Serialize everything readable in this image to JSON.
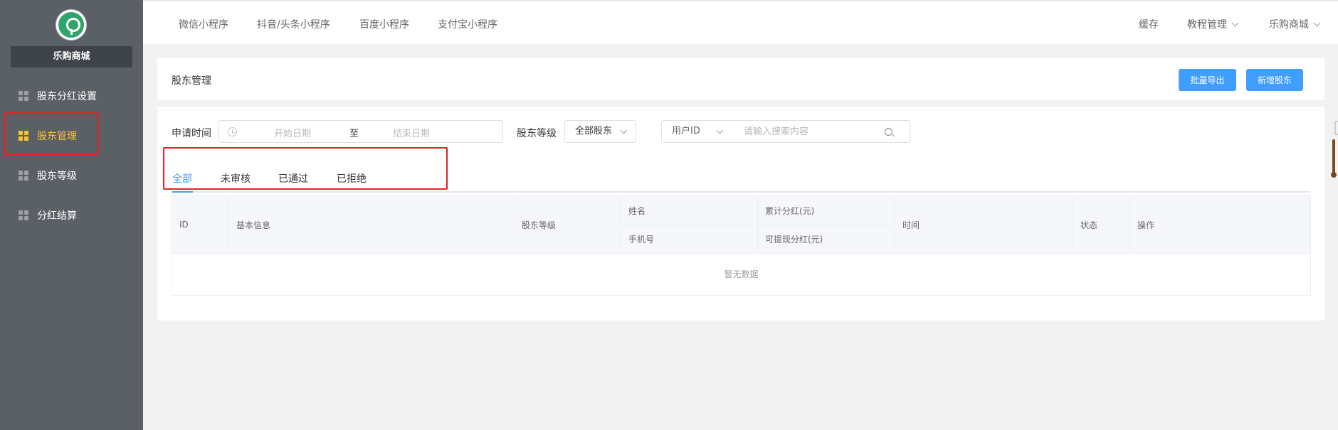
{
  "sidebar": {
    "store_name": "乐购商城",
    "items": [
      {
        "label": "股东分红设置"
      },
      {
        "label": "股东管理"
      },
      {
        "label": "股东等级"
      },
      {
        "label": "分红结算"
      }
    ]
  },
  "topbar": {
    "tabs": [
      {
        "label": "微信小程序"
      },
      {
        "label": "抖音/头条小程序"
      },
      {
        "label": "百度小程序"
      },
      {
        "label": "支付宝小程序"
      }
    ],
    "cache": "缓存",
    "tutorial": "教程管理",
    "store": "乐购商城"
  },
  "header": {
    "title": "股东管理",
    "export_label": "批量导出",
    "add_label": "新增股东"
  },
  "filters": {
    "apply_time_label": "申请时间",
    "start_placeholder": "开始日期",
    "range_separator": "至",
    "end_placeholder": "结束日期",
    "level_label": "股东等级",
    "level_value": "全部股东",
    "search_type": "用户ID",
    "search_placeholder": "请输入搜索内容"
  },
  "tabs": [
    {
      "label": "全部"
    },
    {
      "label": "未审核"
    },
    {
      "label": "已通过"
    },
    {
      "label": "已拒绝"
    }
  ],
  "table": {
    "columns": {
      "id": "ID",
      "basic_info": "基本信息",
      "level": "股东等级",
      "name": "姓名",
      "phone": "手机号",
      "total_dividend": "累计分红(元)",
      "withdrawable_dividend": "可提现分红(元)",
      "time": "时间",
      "status": "状态",
      "action": "操作"
    },
    "empty_text": "暂无数据"
  },
  "colors": {
    "accent": "#409eff",
    "active_nav": "#f9c22e",
    "sidebar_bg": "#5b6066",
    "highlight_box": "#e62020"
  }
}
